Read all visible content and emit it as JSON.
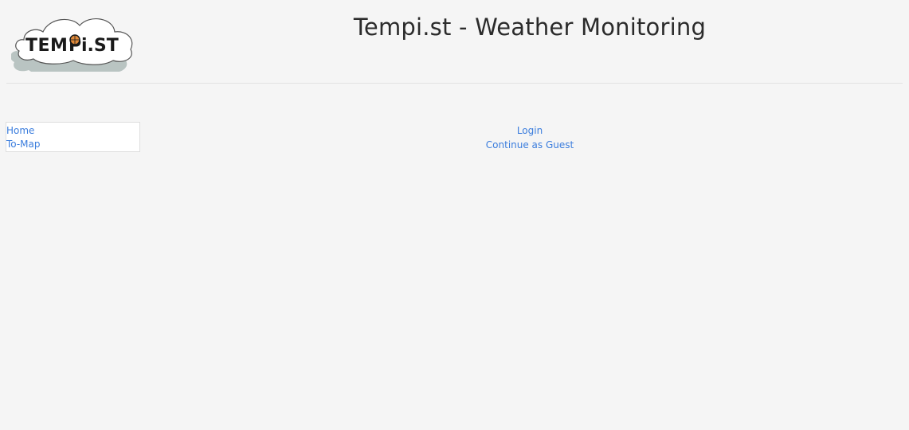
{
  "header": {
    "logo_text": "TEMPi.ST",
    "title": "Tempi.st - Weather Monitoring"
  },
  "sidebar": {
    "items": [
      {
        "label": "Home"
      },
      {
        "label": "To-Map"
      }
    ]
  },
  "auth": {
    "login_label": "Login",
    "guest_label": "Continue as Guest"
  },
  "colors": {
    "background": "#f5f5f5",
    "link": "#3b7ddd",
    "title": "#2b2b2b",
    "cloud": "#ffffff",
    "cloud_shadow": "#b9c4c2"
  }
}
